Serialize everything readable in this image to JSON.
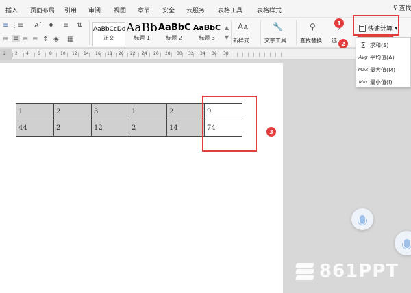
{
  "menu": {
    "items": [
      "插入",
      "页面布局",
      "引用",
      "审阅",
      "视图",
      "章节",
      "安全",
      "云服务",
      "表格工具",
      "表格样式"
    ],
    "search_label": "查找"
  },
  "ribbon": {
    "styles": [
      {
        "sample": "AaBbCcDd",
        "caption": "正文"
      },
      {
        "sample": "AaBb",
        "caption": "标题 1"
      },
      {
        "sample": "AaBbC",
        "caption": "标题 2"
      },
      {
        "sample": "AaBbC",
        "caption": "标题 3"
      }
    ],
    "new_style": "新样式",
    "text_tools": "文字工具",
    "find_replace": "查找替换",
    "select": "选",
    "quick_calc": "快速计算"
  },
  "ruler": {
    "numbers": [
      "2",
      "2",
      "4",
      "6",
      "8",
      "10",
      "12",
      "14",
      "16",
      "18",
      "20",
      "22",
      "24",
      "26",
      "28",
      "30",
      "32",
      "34",
      "36",
      "38"
    ]
  },
  "table": {
    "rows": [
      [
        "1",
        "2",
        "3",
        "1",
        "2",
        "9"
      ],
      [
        "44",
        "2",
        "12",
        "2",
        "14",
        "74"
      ]
    ]
  },
  "dropdown": {
    "items": [
      {
        "icon": "Σ",
        "label": "求和(S)"
      },
      {
        "icon": "Avg",
        "label": "平均值(A)"
      },
      {
        "icon": "Max",
        "label": "最大值(M)"
      },
      {
        "icon": "Min",
        "label": "最小值(I)"
      }
    ]
  },
  "badges": [
    "1",
    "2",
    "3"
  ],
  "watermark": "861PPT",
  "colors": {
    "annotation_red": "#e23d3d",
    "table_fill": "#d0d0d0",
    "accent_blue": "#3a6fb0"
  }
}
